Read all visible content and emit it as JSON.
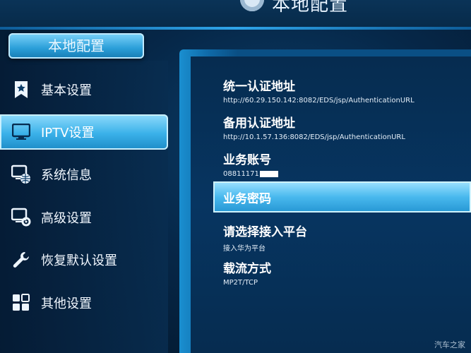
{
  "header": {
    "title": "本地配置"
  },
  "section": {
    "title": "本地配置"
  },
  "menu": [
    {
      "label": "基本设置",
      "icon": "bookmark-icon"
    },
    {
      "label": "IPTV设置",
      "icon": "monitor-icon"
    },
    {
      "label": "系统信息",
      "icon": "system-info-globe-icon"
    },
    {
      "label": "高级设置",
      "icon": "monitor-gear-icon"
    },
    {
      "label": "恢复默认设置",
      "icon": "wrench-icon"
    },
    {
      "label": "其他设置",
      "icon": "grid-icon"
    }
  ],
  "settings": {
    "auth_url": {
      "title": "统一认证地址",
      "value": "http://60.29.150.142:8082/EDS/jsp/AuthenticationURL"
    },
    "backup_auth_url": {
      "title": "备用认证地址",
      "value": "http://10.1.57.136:8082/EDS/jsp/AuthenticationURL"
    },
    "account": {
      "title": "业务账号",
      "value": "08811171"
    },
    "password": {
      "title": "业务密码"
    },
    "platform": {
      "title": "请选择接入平台",
      "value": "接入华为平台"
    },
    "transport": {
      "title": "载流方式",
      "value": "MP2T/TCP"
    }
  },
  "watermark": "汽车之家",
  "colors": {
    "accent": "#3ab1e9",
    "background": "#062748"
  }
}
